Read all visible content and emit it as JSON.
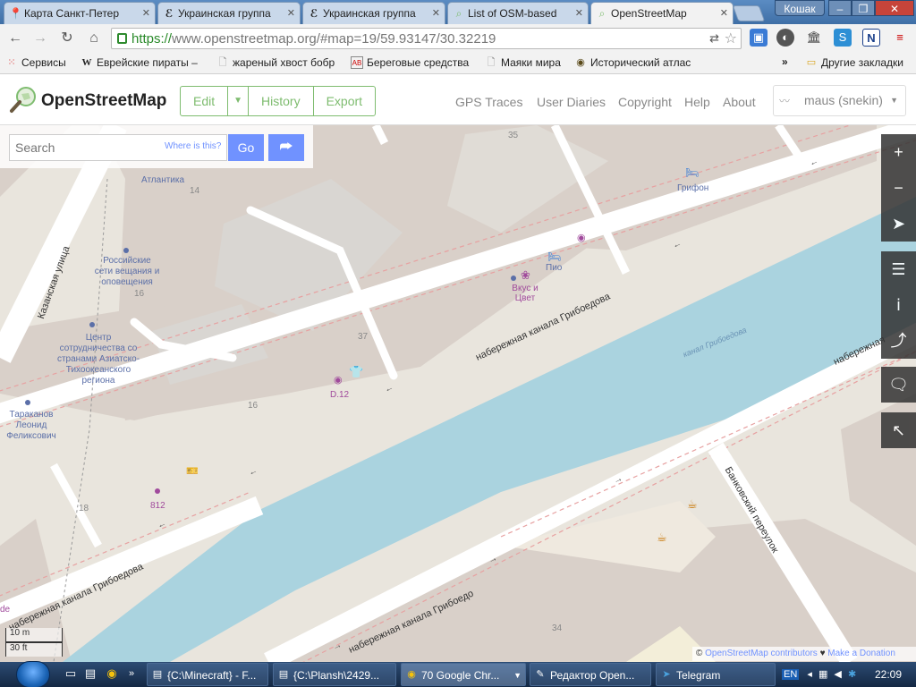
{
  "browser": {
    "tabs": [
      {
        "title": "Карта Санкт-Петер",
        "icon": "map-pin-icon"
      },
      {
        "title": "Украинская группа",
        "icon": "e-icon"
      },
      {
        "title": "Украинская группа",
        "icon": "e-icon"
      },
      {
        "title": "List of OSM-based",
        "icon": "osm-icon"
      },
      {
        "title": "OpenStreetMap",
        "icon": "osm-icon",
        "active": true
      }
    ],
    "profile_name": "Кошак",
    "url": {
      "scheme": "https://",
      "rest": "www.openstreetmap.org/#map=19/59.93147/30.32219"
    },
    "bookmarks": [
      {
        "label": "Сервисы",
        "icon": "apps-grid-icon"
      },
      {
        "label": "Еврейские пираты –",
        "icon": "wikipedia-icon"
      },
      {
        "label": "жареный хвост бобр",
        "icon": "page-icon"
      },
      {
        "label": "Береговые средства",
        "icon": "abc-icon"
      },
      {
        "label": "Маяки мира",
        "icon": "page-icon"
      },
      {
        "label": "Исторический атлас",
        "icon": "globe-icon"
      }
    ],
    "bookmarks_overflow": "»",
    "other_bookmarks": "Другие закладки"
  },
  "osm": {
    "brand": "OpenStreetMap",
    "edit": "Edit",
    "history": "History",
    "export": "Export",
    "nav": [
      "GPS Traces",
      "User Diaries",
      "Copyright",
      "Help",
      "About"
    ],
    "user": "maus (snekin)",
    "search_placeholder": "Search",
    "where_is_this": "Where is this?",
    "go": "Go"
  },
  "map": {
    "streets": {
      "kazanskaya": "Казанская улица",
      "embankment_north": "набережная канала Грибоедова",
      "embankment_south_left": "набережная канала Грибоедова",
      "embankment_south": "набережная канала Грибоедо",
      "embankment_right": "набережная",
      "bankovsky": "Банковский переулок",
      "canal": "канал Грибоедова"
    },
    "house_numbers": [
      "35",
      "14",
      "16",
      "37",
      "16",
      "18",
      "34"
    ],
    "pois": {
      "atlantika": "Атлантика",
      "russian_networks": "Российские сети вещания и оповещения",
      "center": "Центр сотрудничества со странами Азиатско-Тихоокеанского региона",
      "person": "Тараканов Леонид Феликсович",
      "vkus": "Вкус и Цвет",
      "pio": "Пио",
      "grifon": "Грифон",
      "d12": "D.12",
      "n812": "812",
      "edge_label": "de"
    },
    "scale": {
      "metric": "10 m",
      "imperial": "30 ft"
    },
    "attribution": {
      "copyright": "©",
      "contributors": "OpenStreetMap contributors",
      "heart": "♥",
      "donate": "Make a Donation"
    }
  },
  "taskbar": {
    "tasks": [
      {
        "label": "{C:\\Minecraft} - F...",
        "icon": "folder-icon"
      },
      {
        "label": "{C:\\Plansh\\2429...",
        "icon": "folder-icon"
      },
      {
        "label": "70 Google Chr...",
        "icon": "chrome-icon"
      },
      {
        "label": "Редактор Open...",
        "icon": "editor-icon"
      },
      {
        "label": "Telegram",
        "icon": "telegram-icon"
      }
    ],
    "lang": "EN",
    "time": "22:09"
  }
}
